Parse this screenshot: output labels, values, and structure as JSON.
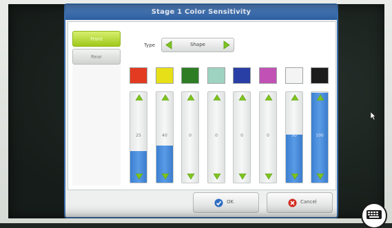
{
  "dialog": {
    "title": "Stage 1 Color Sensitivity",
    "tabs": [
      {
        "label": "Front",
        "active": true
      },
      {
        "label": "Rear",
        "active": false
      }
    ],
    "type_label": "Type",
    "type_value": "Shape"
  },
  "colors": [
    {
      "name": "red",
      "hex": "#e23b22",
      "value": "25",
      "level": 0.34
    },
    {
      "name": "yellow",
      "hex": "#e7df18",
      "value": "40",
      "level": 0.4
    },
    {
      "name": "green",
      "hex": "#2e7d25",
      "value": "0",
      "level": 0
    },
    {
      "name": "light-teal",
      "hex": "#9fd3c1",
      "value": "0",
      "level": 0
    },
    {
      "name": "blue",
      "hex": "#2a3fa6",
      "value": "0",
      "level": 0
    },
    {
      "name": "purple",
      "hex": "#c251b6",
      "value": "0",
      "level": 0
    },
    {
      "name": "white",
      "hex": "#f4f4f4",
      "value": "50",
      "level": 0.52
    },
    {
      "name": "black",
      "hex": "#1c1c1c",
      "value": "100",
      "level": 0.98
    }
  ],
  "footer": {
    "ok_label": "OK",
    "cancel_label": "Cancel"
  },
  "icons": {
    "arrow_left": "chevron-left-icon",
    "arrow_right": "chevron-right-icon",
    "ok": "ok-icon",
    "cancel": "cancel-icon",
    "keyboard": "keyboard-icon"
  },
  "accent_colors": {
    "title_bar": "#2d5e9f",
    "active_tab": "#9fc91b",
    "slider_fill": "#3b7fd0",
    "arrows": "#7fc41f"
  }
}
